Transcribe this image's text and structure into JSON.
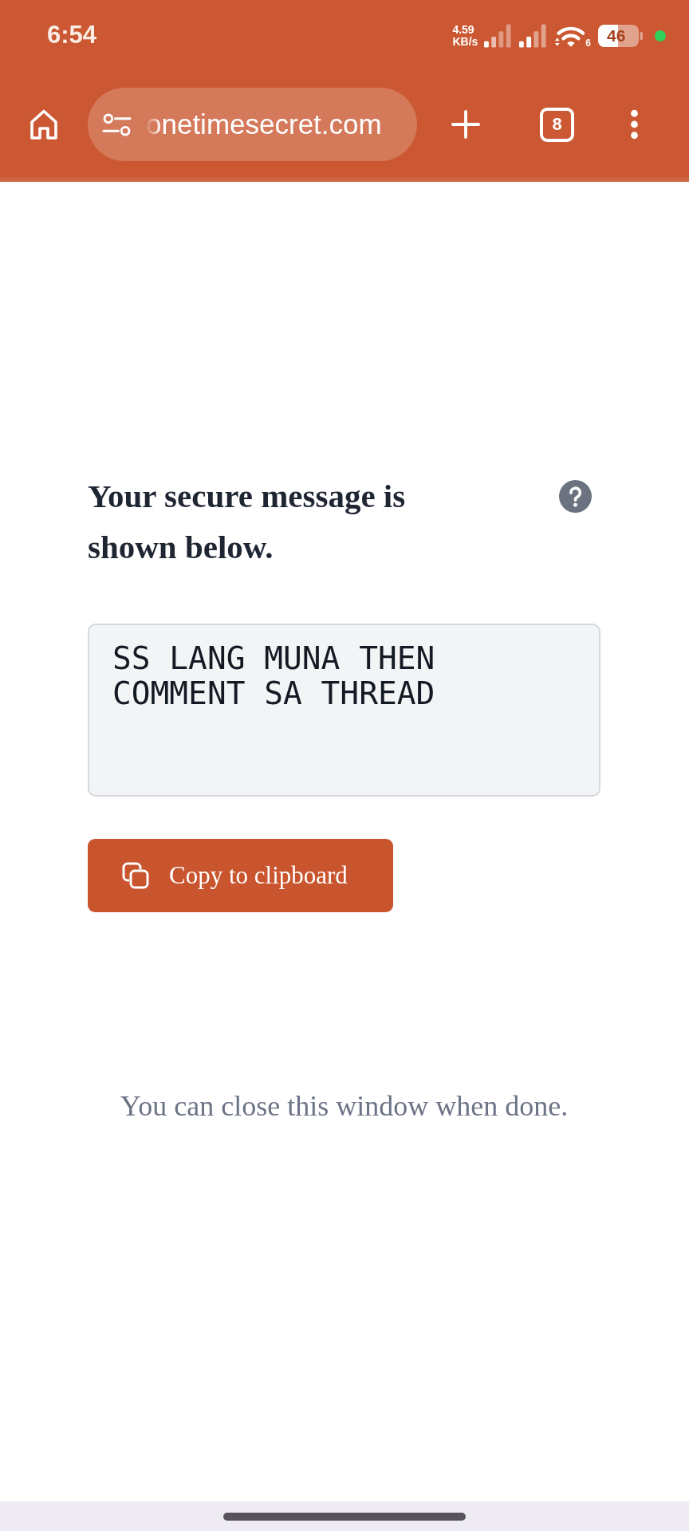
{
  "status_bar": {
    "time": "6:54",
    "speed_value": "4.59",
    "speed_unit": "KB/s",
    "wifi_label": "6",
    "battery": "46"
  },
  "browser_toolbar": {
    "url": "onetimesecret.com",
    "tab_count": "8"
  },
  "secret": {
    "heading": "Your secure message is shown below.",
    "message": "SS LANG MUNA THEN COMMENT SA THREAD",
    "copy_button": "Copy to clipboard",
    "footer_note": "You can close this window when done."
  }
}
